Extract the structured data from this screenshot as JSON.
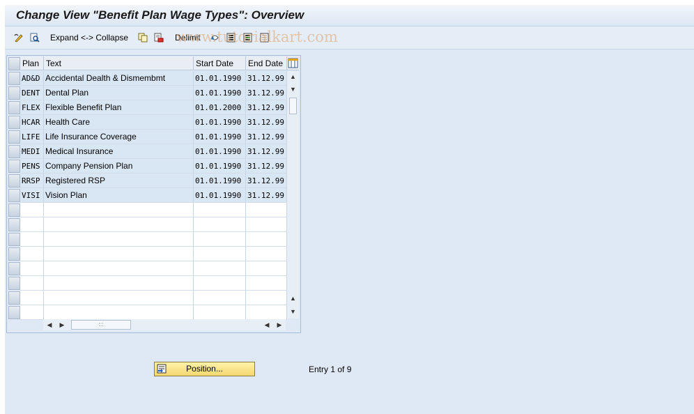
{
  "window": {
    "title": "Change View \"Benefit Plan Wage Types\": Overview"
  },
  "toolbar": {
    "expand_collapse_label": "Expand <-> Collapse",
    "delimit_label": "Delimit",
    "icons": [
      "edit-glasses-icon",
      "find-icon",
      "copy-icon",
      "delete-icon",
      "undo-icon",
      "select-all-icon",
      "select-block-icon",
      "deselect-all-icon"
    ]
  },
  "watermark": {
    "text": "www.tutorialkart.com"
  },
  "table": {
    "columns": [
      "Plan",
      "Text",
      "Start Date",
      "End Date"
    ],
    "rows": [
      {
        "plan": "AD&D",
        "text": "Accidental Dealth & Dismembmt",
        "start": "01.01.1990",
        "end": "31.12.99"
      },
      {
        "plan": "DENT",
        "text": "Dental Plan",
        "start": "01.01.1990",
        "end": "31.12.99"
      },
      {
        "plan": "FLEX",
        "text": "Flexible Benefit Plan",
        "start": "01.01.2000",
        "end": "31.12.99"
      },
      {
        "plan": "HCAR",
        "text": "Health Care",
        "start": "01.01.1990",
        "end": "31.12.99"
      },
      {
        "plan": "LIFE",
        "text": "Life Insurance Coverage",
        "start": "01.01.1990",
        "end": "31.12.99"
      },
      {
        "plan": "MEDI",
        "text": "Medical Insurance",
        "start": "01.01.1990",
        "end": "31.12.99"
      },
      {
        "plan": "PENS",
        "text": "Company Pension Plan",
        "start": "01.01.1990",
        "end": "31.12.99"
      },
      {
        "plan": "RRSP",
        "text": "Registered RSP",
        "start": "01.01.1990",
        "end": "31.12.99"
      },
      {
        "plan": "VISI",
        "text": "Vision Plan",
        "start": "01.01.1990",
        "end": "31.12.99"
      }
    ]
  },
  "footer": {
    "position_button": "Position...",
    "entry_text": "Entry 1 of 9"
  },
  "colors": {
    "background": "#dfe9f5",
    "button_yellow": "#f4d770",
    "row_fill": "#d9e6f3"
  }
}
